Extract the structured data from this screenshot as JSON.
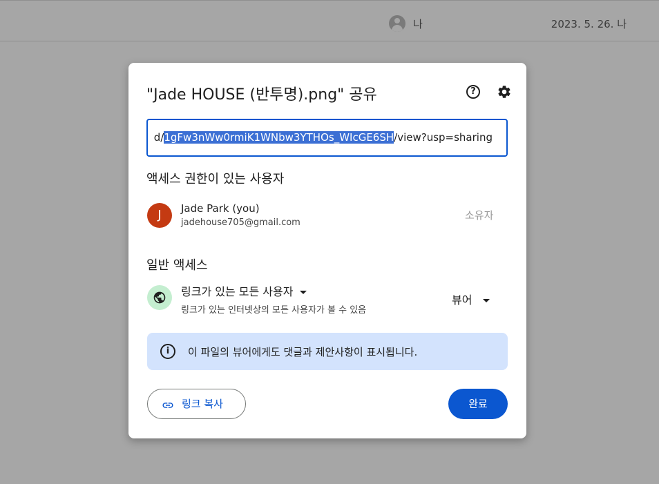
{
  "topbar": {
    "owner_label": "나",
    "modified": "2023. 5. 26. 나"
  },
  "dialog": {
    "title": "\"Jade HOUSE (반투명).png\" 공유",
    "link": {
      "prefix": "d/",
      "selected": "1gFw3nWw0rmiK1WNbw3YTHOs_WIcGE6SH",
      "suffix": "/view?usp=sharing"
    },
    "people_section_title": "액세스 권한이 있는 사용자",
    "person": {
      "initial": "J",
      "name": "Jade Park (you)",
      "email": "jadehouse705@gmail.com",
      "role": "소유자",
      "avatar_color": "#c43a12"
    },
    "general_section_title": "일반 액세스",
    "general_access": {
      "selected": "링크가 있는 모든 사용자",
      "description": "링크가 있는 인터넷상의 모든 사용자가 볼 수 있음",
      "role": "뷰어"
    },
    "info_banner": "이 파일의 뷰어에게도 댓글과 제안사항이 표시됩니다.",
    "copy_link_label": "링크 복사",
    "done_label": "완료",
    "accent_color": "#0b57d0"
  }
}
